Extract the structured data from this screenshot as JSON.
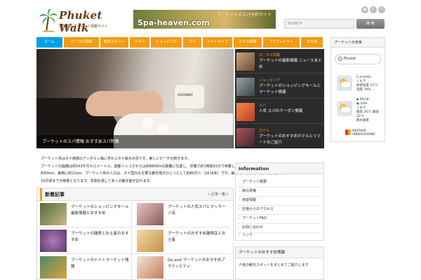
{
  "header": {
    "logo_title": "Phuket Walk",
    "logo_sub": "現地発信プーケット情報サイト",
    "banner_top": "プーケットのスパ予約サイト",
    "banner_main": "Spa-heaven.com",
    "social": [
      "rss-icon",
      "twitter-icon",
      "facebook-icon"
    ],
    "search_placeholder": "SEARCH",
    "search_button": "検 索"
  },
  "nav": {
    "items": [
      {
        "label": "ホーム",
        "active": true
      },
      {
        "label": "ローカル情報",
        "active": false
      },
      {
        "label": "観光スポット",
        "active": false
      },
      {
        "label": "グルメ",
        "active": false
      },
      {
        "label": "ショッピング",
        "active": false
      },
      {
        "label": "スパ",
        "active": false
      },
      {
        "label": "ナイトライフ",
        "active": false
      },
      {
        "label": "ホテル情報",
        "active": false
      },
      {
        "label": "アクティビティ",
        "active": false
      },
      {
        "label": "その他",
        "active": false
      }
    ]
  },
  "slider": {
    "caption": "プーケットのスパ情報 おすすめスパ特集",
    "jar_label": "COCONUT",
    "items": [
      {
        "category": "ローカル情報",
        "title": "プーケットの最新情報 ニュースまとめ"
      },
      {
        "category": "ショッピング",
        "title": "プーケットのショッピングモールとマーケット情報"
      },
      {
        "category": "スパ",
        "title": "人気 スパのクーポン情報"
      },
      {
        "category": "ホテル",
        "title": "プーケットのおすすめホテルとリゾートのご紹介"
      }
    ]
  },
  "intro": {
    "lines": [
      "プーケット島はタイ南部のアンダマン海に浮かぶタイ最大の島です。美しいビーチが続きます。",
      "プーケットの面積は約543平方キロメートル、首都バンコクからは約860Kmの距離に位置し、空路で約1時間20分で到着します。島の大きさは南北に",
      "約50km、東西に約21km。プーケット県の人口は、タイ国内の主要な観光地のひとつとして約60万人（2014年）です。毎年約11月から4月までが乾季で、",
      "10月頃までが雨季となります。年間を通して多くの観光客が訪れます。"
    ]
  },
  "new_articles": {
    "title": "新着記事",
    "more": "» 記事一覧へ",
    "items": [
      {
        "title": "プーケットのショッピングモール最新情報とおすすめ"
      },
      {
        "title": "プーケットの人気スパとマッサージ店"
      },
      {
        "title": "プーケットの雑貨とお土産のおすすめ"
      },
      {
        "title": "プーケットのおすすめ雑貨店とお土産"
      },
      {
        "title": "プーケットのナイトマーケット情報"
      },
      {
        "title": "Go and プーケットのおすすめアクティビティ"
      }
    ]
  },
  "information": {
    "title": "Information",
    "items": [
      "プーケット概要",
      "旅の準備",
      "両替情報",
      "空港からのアクセス",
      "プーケットFAQ",
      "お問い合わせ",
      "リンク"
    ]
  },
  "recommend": {
    "title": "プーケットのおすすめ情報",
    "items": [
      "人気の観光スポットをまとめてご紹介します"
    ]
  },
  "weather": {
    "title": "プーケットの天気",
    "search_value": "Phuket",
    "current_label": "Currently",
    "current_lines": [
      "くもり",
      "体感温度 33°C",
      "湿度 78%"
    ],
    "forecast_date": "09/18",
    "forecast_rain": "10%",
    "forecast_lines": [
      "くもり",
      "最高 30°C 最低 25°C",
      "降水確率"
    ],
    "brand_line1": "WEATHER",
    "brand_line2": "UNDERGROUND"
  },
  "colors": {
    "accent": "#f39c12",
    "nav_active": "#00a0e9",
    "slider_list_bg": "#2b2b2b",
    "text": "#222222"
  }
}
